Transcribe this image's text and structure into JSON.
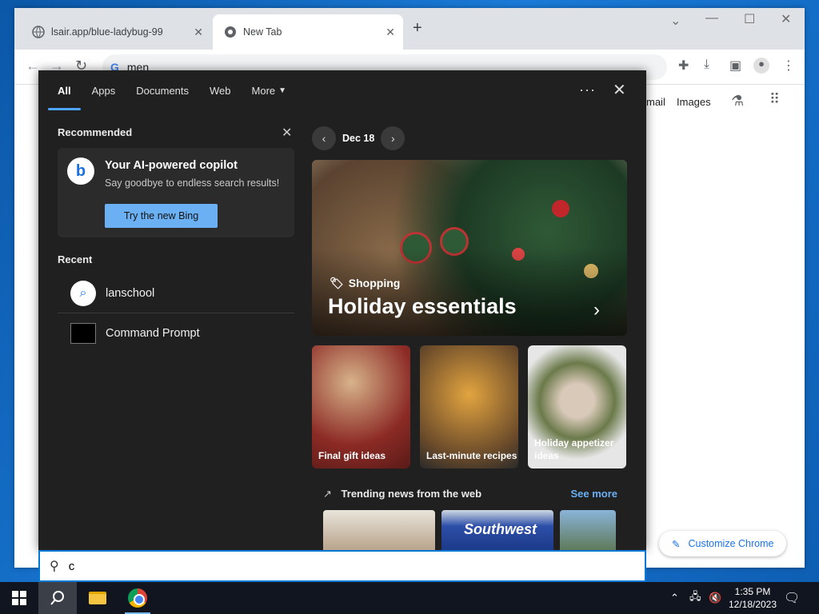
{
  "browser": {
    "tabs": [
      {
        "title": "lsair.app/blue-ladybug-99",
        "active": false
      },
      {
        "title": "New Tab",
        "active": true
      }
    ],
    "new_tab_symbol": "+",
    "window_controls": {
      "dropdown": "⌄",
      "minimize": "—",
      "maximize": "☐",
      "close": "✕"
    },
    "address_text": "men",
    "page_links": {
      "gmail_partial": "mail",
      "images": "Images"
    },
    "customize_label": "Customize Chrome"
  },
  "flyout": {
    "tabs": [
      "All",
      "Apps",
      "Documents",
      "Web",
      "More"
    ],
    "active_tab": "All",
    "recommended_title": "Recommended",
    "bing_card": {
      "title": "Your AI-powered copilot",
      "subtitle": "Say goodbye to endless search results!",
      "button": "Try the new Bing"
    },
    "recent_title": "Recent",
    "recent_items": [
      {
        "label": "lanschool",
        "icon": "search-icon"
      },
      {
        "label": "Command Prompt",
        "icon": "cmd-icon"
      }
    ],
    "date_label": "Dec 18",
    "hero": {
      "tag": "Shopping",
      "title": "Holiday essentials"
    },
    "cards": [
      {
        "label": "Final gift ideas"
      },
      {
        "label": "Last-minute recipes"
      },
      {
        "label": "Holiday appetizer ideas"
      }
    ],
    "trending_title": "Trending news from the web",
    "see_more": "See more",
    "news_logo_text": "Southwest"
  },
  "search_box": {
    "value": "c"
  },
  "taskbar": {
    "time": "1:35 PM",
    "date": "12/18/2023"
  },
  "colors": {
    "accent": "#0078d4",
    "link": "#6ab0f3",
    "flyout_bg": "#202020"
  }
}
